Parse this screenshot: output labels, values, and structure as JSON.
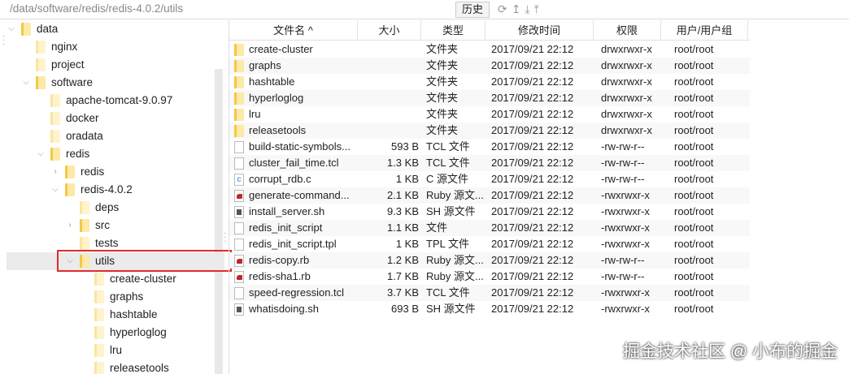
{
  "toolbar": {
    "path": "/data/software/redis/redis-4.0.2/utils",
    "history_label": "历史",
    "icons": [
      "refresh-icon",
      "up-icon",
      "download-icon",
      "upload-icon"
    ]
  },
  "tree": [
    {
      "label": "data",
      "level": 0,
      "chev": "⌵"
    },
    {
      "label": "nginx",
      "level": 1,
      "chev": ""
    },
    {
      "label": "project",
      "level": 1,
      "chev": ""
    },
    {
      "label": "software",
      "level": 1,
      "chev": "⌵"
    },
    {
      "label": "apache-tomcat-9.0.97",
      "level": 2,
      "chev": ""
    },
    {
      "label": "docker",
      "level": 2,
      "chev": ""
    },
    {
      "label": "oradata",
      "level": 2,
      "chev": ""
    },
    {
      "label": "redis",
      "level": 2,
      "chev": "⌵"
    },
    {
      "label": "redis",
      "level": 3,
      "chev": "›"
    },
    {
      "label": "redis-4.0.2",
      "level": 3,
      "chev": "⌵"
    },
    {
      "label": "deps",
      "level": 4,
      "chev": ""
    },
    {
      "label": "src",
      "level": 4,
      "chev": "›"
    },
    {
      "label": "tests",
      "level": 4,
      "chev": ""
    },
    {
      "label": "utils",
      "level": 4,
      "chev": "⌵",
      "selected": true
    },
    {
      "label": "create-cluster",
      "level": 5,
      "chev": ""
    },
    {
      "label": "graphs",
      "level": 5,
      "chev": ""
    },
    {
      "label": "hashtable",
      "level": 5,
      "chev": ""
    },
    {
      "label": "hyperloglog",
      "level": 5,
      "chev": ""
    },
    {
      "label": "lru",
      "level": 5,
      "chev": ""
    },
    {
      "label": "releasetools",
      "level": 5,
      "chev": ""
    }
  ],
  "columns": [
    "文件名 ^",
    "大小",
    "类型",
    "修改时间",
    "权限",
    "用户/用户组"
  ],
  "files": [
    {
      "name": "create-cluster",
      "size": "",
      "type": "文件夹",
      "time": "2017/09/21 22:12",
      "perm": "drwxrwxr-x",
      "owner": "root/root",
      "icon": "folder"
    },
    {
      "name": "graphs",
      "size": "",
      "type": "文件夹",
      "time": "2017/09/21 22:12",
      "perm": "drwxrwxr-x",
      "owner": "root/root",
      "icon": "folder"
    },
    {
      "name": "hashtable",
      "size": "",
      "type": "文件夹",
      "time": "2017/09/21 22:12",
      "perm": "drwxrwxr-x",
      "owner": "root/root",
      "icon": "folder"
    },
    {
      "name": "hyperloglog",
      "size": "",
      "type": "文件夹",
      "time": "2017/09/21 22:12",
      "perm": "drwxrwxr-x",
      "owner": "root/root",
      "icon": "folder"
    },
    {
      "name": "lru",
      "size": "",
      "type": "文件夹",
      "time": "2017/09/21 22:12",
      "perm": "drwxrwxr-x",
      "owner": "root/root",
      "icon": "folder"
    },
    {
      "name": "releasetools",
      "size": "",
      "type": "文件夹",
      "time": "2017/09/21 22:12",
      "perm": "drwxrwxr-x",
      "owner": "root/root",
      "icon": "folder"
    },
    {
      "name": "build-static-symbols...",
      "size": "593 B",
      "type": "TCL 文件",
      "time": "2017/09/21 22:12",
      "perm": "-rw-rw-r--",
      "owner": "root/root",
      "icon": "file"
    },
    {
      "name": "cluster_fail_time.tcl",
      "size": "1.3 KB",
      "type": "TCL 文件",
      "time": "2017/09/21 22:12",
      "perm": "-rw-rw-r--",
      "owner": "root/root",
      "icon": "file"
    },
    {
      "name": "corrupt_rdb.c",
      "size": "1 KB",
      "type": "C 源文件",
      "time": "2017/09/21 22:12",
      "perm": "-rw-rw-r--",
      "owner": "root/root",
      "icon": "c"
    },
    {
      "name": "generate-command...",
      "size": "2.1 KB",
      "type": "Ruby 源文...",
      "time": "2017/09/21 22:12",
      "perm": "-rwxrwxr-x",
      "owner": "root/root",
      "icon": "rb"
    },
    {
      "name": "install_server.sh",
      "size": "9.3 KB",
      "type": "SH 源文件",
      "time": "2017/09/21 22:12",
      "perm": "-rwxrwxr-x",
      "owner": "root/root",
      "icon": "sh"
    },
    {
      "name": "redis_init_script",
      "size": "1.1 KB",
      "type": "文件",
      "time": "2017/09/21 22:12",
      "perm": "-rwxrwxr-x",
      "owner": "root/root",
      "icon": "file"
    },
    {
      "name": "redis_init_script.tpl",
      "size": "1 KB",
      "type": "TPL 文件",
      "time": "2017/09/21 22:12",
      "perm": "-rwxrwxr-x",
      "owner": "root/root",
      "icon": "file"
    },
    {
      "name": "redis-copy.rb",
      "size": "1.2 KB",
      "type": "Ruby 源文...",
      "time": "2017/09/21 22:12",
      "perm": "-rw-rw-r--",
      "owner": "root/root",
      "icon": "rb"
    },
    {
      "name": "redis-sha1.rb",
      "size": "1.7 KB",
      "type": "Ruby 源文...",
      "time": "2017/09/21 22:12",
      "perm": "-rw-rw-r--",
      "owner": "root/root",
      "icon": "rb"
    },
    {
      "name": "speed-regression.tcl",
      "size": "3.7 KB",
      "type": "TCL 文件",
      "time": "2017/09/21 22:12",
      "perm": "-rwxrwxr-x",
      "owner": "root/root",
      "icon": "file"
    },
    {
      "name": "whatisdoing.sh",
      "size": "693 B",
      "type": "SH 源文件",
      "time": "2017/09/21 22:12",
      "perm": "-rwxrwxr-x",
      "owner": "root/root",
      "icon": "sh"
    }
  ],
  "watermark": "掘金技术社区 @ 小布的掘金"
}
